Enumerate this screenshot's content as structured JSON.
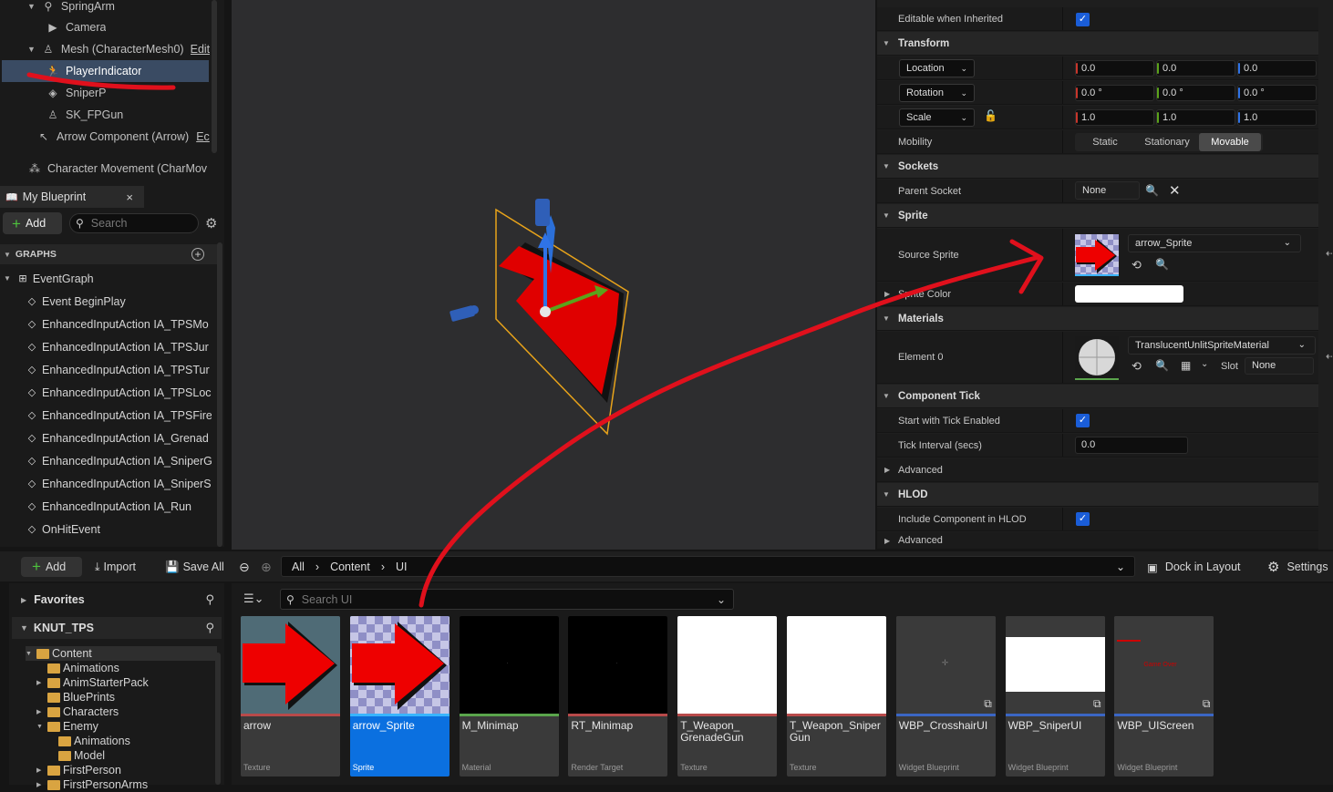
{
  "component_tree": {
    "items": [
      {
        "label": "SpringArm",
        "icon": "spring-arm-icon"
      },
      {
        "label": "Camera",
        "icon": "camera-icon"
      },
      {
        "label": "Mesh (CharacterMesh0)",
        "edit": "Edit",
        "icon": "skeletal-mesh-icon"
      },
      {
        "label": "PlayerIndicator",
        "icon": "paper-sprite-icon",
        "selected": true
      },
      {
        "label": "SniperP",
        "icon": "static-mesh-icon"
      },
      {
        "label": "SK_FPGun",
        "icon": "skeletal-mesh-icon"
      },
      {
        "label": "Arrow Component (Arrow)",
        "edit": "Ec",
        "icon": "arrow-icon"
      },
      {
        "label": "Character Movement (CharMov",
        "icon": "movement-icon"
      }
    ]
  },
  "my_blueprint": {
    "tab_label": "My Blueprint",
    "close": "×",
    "add_label": "Add",
    "search_placeholder": "Search",
    "graphs_label": "GRAPHS",
    "graphs": [
      "EventGraph",
      "Event BeginPlay",
      "EnhancedInputAction IA_TPSMo",
      "EnhancedInputAction IA_TPSJur",
      "EnhancedInputAction IA_TPSTur",
      "EnhancedInputAction IA_TPSLoc",
      "EnhancedInputAction IA_TPSFire",
      "EnhancedInputAction IA_Grenad",
      "EnhancedInputAction IA_SniperG",
      "EnhancedInputAction IA_SniperS",
      "EnhancedInputAction IA_Run",
      "OnHitEvent"
    ]
  },
  "details": {
    "editable_when_inherited": "Editable when Inherited",
    "transform": "Transform",
    "location": {
      "label": "Location",
      "values": [
        "0.0",
        "0.0",
        "0.0"
      ]
    },
    "rotation": {
      "label": "Rotation",
      "values": [
        "0.0 °",
        "0.0 °",
        "0.0 °"
      ]
    },
    "scale": {
      "label": "Scale",
      "values": [
        "1.0",
        "1.0",
        "1.0"
      ]
    },
    "mobility": {
      "label": "Mobility",
      "options": [
        "Static",
        "Stationary",
        "Movable"
      ],
      "selected": "Movable"
    },
    "sockets": "Sockets",
    "parent_socket": {
      "label": "Parent Socket",
      "value": "None"
    },
    "sprite": "Sprite",
    "source_sprite": {
      "label": "Source Sprite",
      "value": "arrow_Sprite"
    },
    "sprite_color": {
      "label": "Sprite Color"
    },
    "materials": "Materials",
    "element0": {
      "label": "Element 0",
      "value": "TranslucentUnlitSpriteMaterial",
      "slot_label": "Slot",
      "slot_value": "None"
    },
    "component_tick": "Component Tick",
    "start_tick": "Start with Tick Enabled",
    "tick_interval": {
      "label": "Tick Interval (secs)",
      "value": "0.0"
    },
    "advanced": "Advanced",
    "hlod": "HLOD",
    "include_hlod": "Include Component in HLOD",
    "advanced2": "Advanced"
  },
  "content_browser": {
    "add": "Add",
    "import": "Import",
    "save_all": "Save All",
    "path": [
      "All",
      "Content",
      "UI"
    ],
    "dock": "Dock in Layout",
    "settings": "Settings",
    "favorites": "Favorites",
    "project": "KNUT_TPS",
    "search_placeholder": "Search UI",
    "folders": [
      {
        "label": "Content",
        "level": 1,
        "open": true
      },
      {
        "label": "Animations",
        "level": 2
      },
      {
        "label": "AnimStarterPack",
        "level": 2,
        "arrow": true
      },
      {
        "label": "BluePrints",
        "level": 2
      },
      {
        "label": "Characters",
        "level": 2,
        "arrow": true
      },
      {
        "label": "Enemy",
        "level": 2,
        "arrow": true,
        "open": true
      },
      {
        "label": "Animations",
        "level": 3
      },
      {
        "label": "Model",
        "level": 3
      },
      {
        "label": "FirstPerson",
        "level": 2,
        "arrow": true
      },
      {
        "label": "FirstPersonArms",
        "level": 2,
        "arrow": true
      }
    ],
    "assets": [
      {
        "name": "arrow",
        "type": "Texture",
        "color": "#b84a4a",
        "thumb": "arrow-dark"
      },
      {
        "name": "arrow_Sprite",
        "type": "Sprite",
        "color": "#39b4ff",
        "thumb": "arrow-checker",
        "selected": true
      },
      {
        "name": "M_Minimap",
        "type": "Material",
        "color": "#5aa54c",
        "thumb": "black"
      },
      {
        "name": "RT_Minimap",
        "type": "Render Target",
        "color": "#b84a4a",
        "thumb": "black"
      },
      {
        "name": "T_Weapon_ GrenadeGun",
        "type": "Texture",
        "color": "#b84a4a",
        "thumb": "white"
      },
      {
        "name": "T_Weapon_Sniper Gun",
        "type": "Texture",
        "color": "#b84a4a",
        "thumb": "white"
      },
      {
        "name": "WBP_CrosshairUI",
        "type": "Widget Blueprint",
        "color": "#3b66c4",
        "thumb": "grey"
      },
      {
        "name": "WBP_SniperUI",
        "type": "Widget Blueprint",
        "color": "#3b66c4",
        "thumb": "white-band"
      },
      {
        "name": "WBP_UIScreen",
        "type": "Widget Blueprint",
        "color": "#3b66c4",
        "thumb": "gameover",
        "thumb_text": "Game Over"
      }
    ]
  },
  "colors": {
    "annotation": "#e0101c",
    "accent": "#1a5dd8",
    "selection": "#0b70e0"
  }
}
